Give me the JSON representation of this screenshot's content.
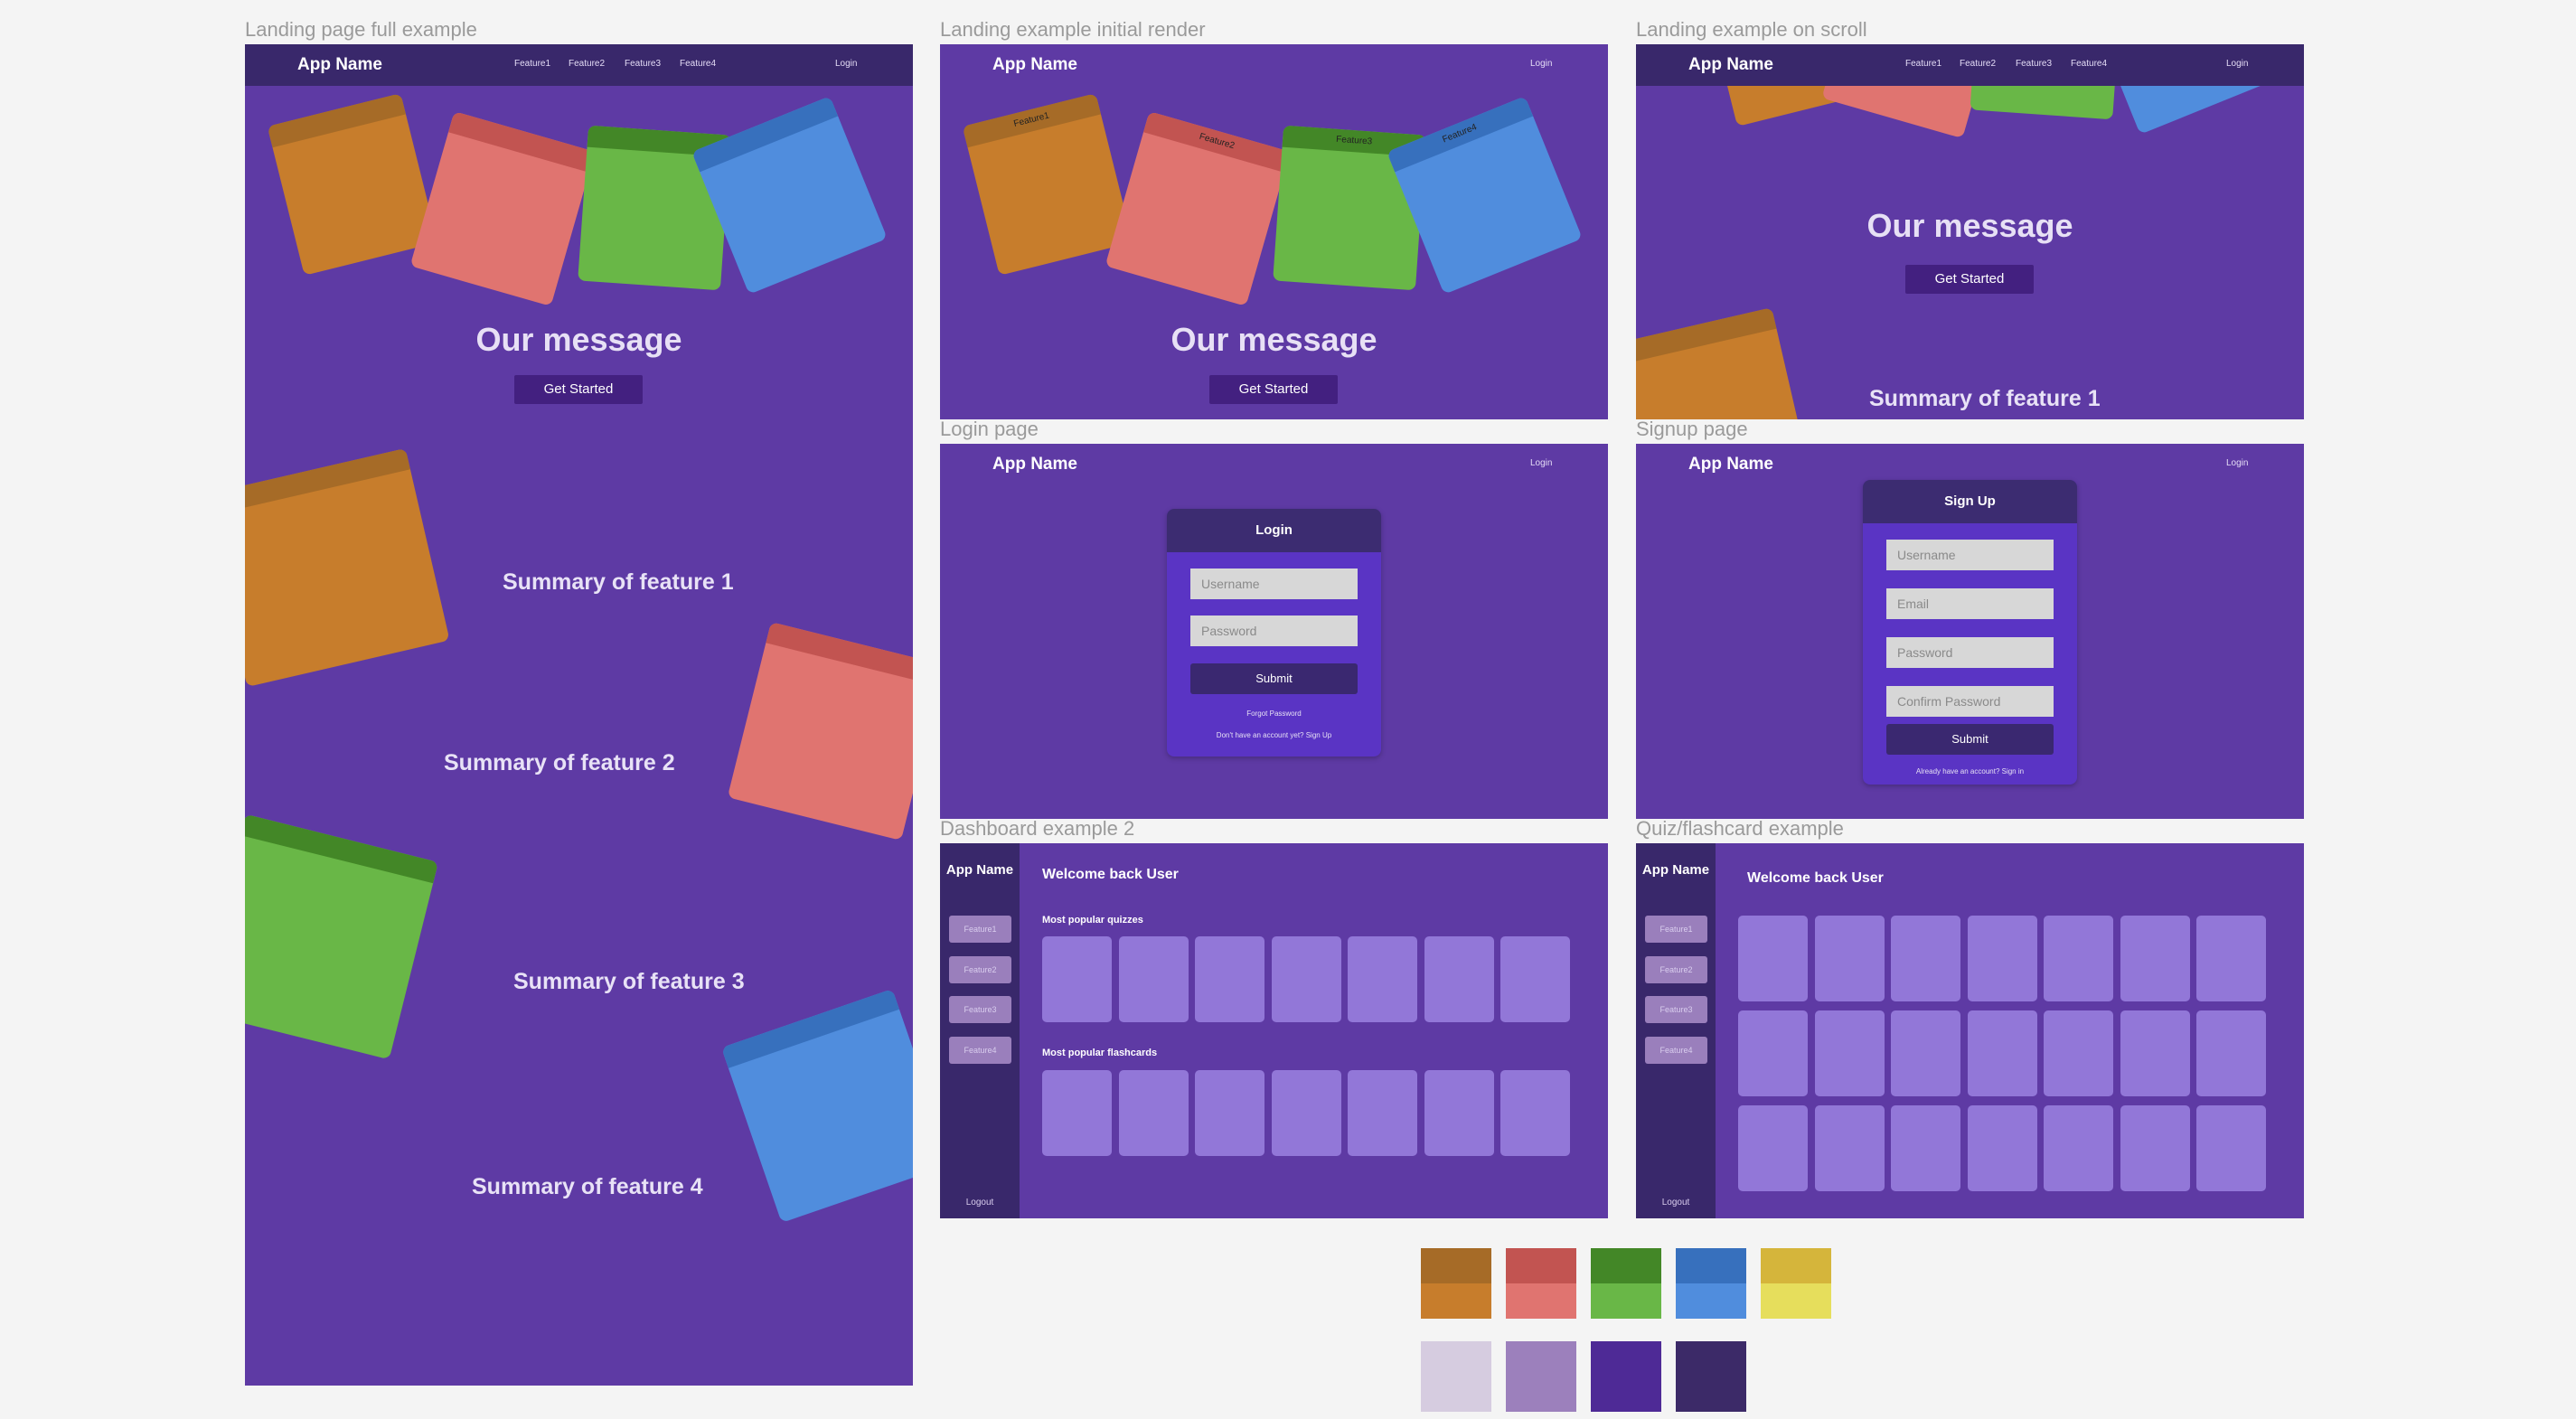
{
  "frames": {
    "full": "Landing page full example",
    "initial": "Landing example initial render",
    "scroll": "Landing example on scroll",
    "login": "Login page",
    "signup": "Signup page",
    "dashboard": "Dashboard example 2",
    "quiz": "Quiz/flashcard example"
  },
  "app_name": "App Name",
  "nav": {
    "features": [
      "Feature1",
      "Feature2",
      "Feature3",
      "Feature4"
    ],
    "login": "Login"
  },
  "hero": {
    "message": "Our message",
    "cta": "Get Started"
  },
  "summaries": [
    "Summary of feature 1",
    "Summary of feature 2",
    "Summary of feature 3",
    "Summary of feature 4"
  ],
  "login": {
    "title": "Login",
    "username_placeholder": "Username",
    "password_placeholder": "Password",
    "submit": "Submit",
    "forgot": "Forgot Password",
    "signup_prompt": "Don't have an account yet? Sign Up"
  },
  "signup": {
    "title": "Sign Up",
    "username_placeholder": "Username",
    "email_placeholder": "Email",
    "password_placeholder": "Password",
    "confirm_placeholder": "Confirm Password",
    "submit": "Submit",
    "signin_prompt": "Already have an account? Sign in"
  },
  "dashboard": {
    "side_app": "App Name",
    "side_items": [
      "Feature1",
      "Feature2",
      "Feature3",
      "Feature4"
    ],
    "logout": "Logout",
    "welcome": "Welcome back User",
    "quizzes_heading": "Most popular quizzes",
    "flashcards_heading": "Most popular flashcards"
  },
  "colors": {
    "background": "#5e3aa4",
    "nav": "#39286b",
    "palette_pairs": [
      [
        "#a66b27",
        "#c77d2c"
      ],
      [
        "#c25451",
        "#e07470"
      ],
      [
        "#438727",
        "#69b747"
      ],
      [
        "#3770bd",
        "#508ddd"
      ],
      [
        "#d5b53b",
        "#e6de5c"
      ]
    ],
    "palette_purples": [
      "#d6cce0",
      "#9c80bc",
      "#4e2a96",
      "#3c2a68"
    ]
  }
}
